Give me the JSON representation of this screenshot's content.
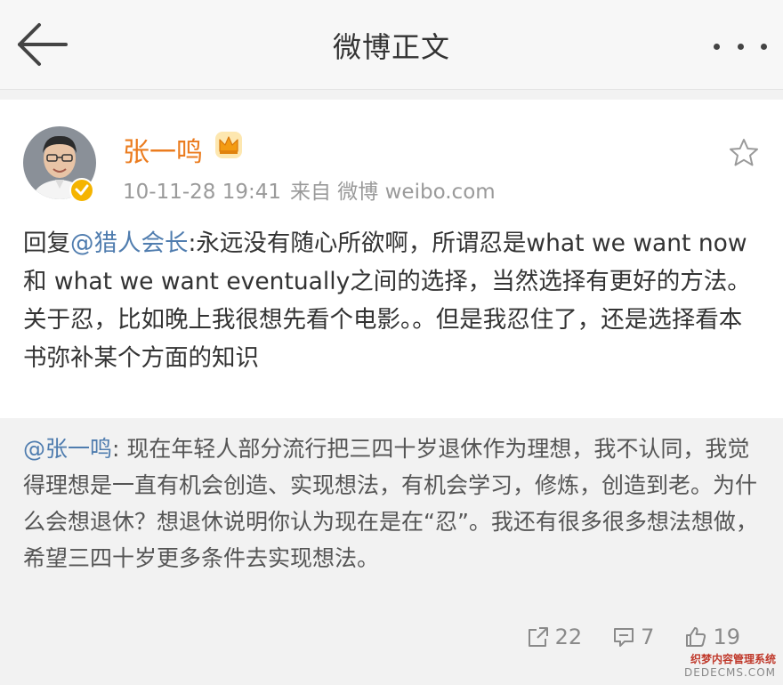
{
  "header": {
    "title": "微博正文"
  },
  "post": {
    "author": "张一鸣",
    "timestamp": "10-11-28 19:41",
    "source": "来自 微博 weibo.com",
    "content": {
      "prefix": "回复",
      "mention": "@猎人会长",
      "text": ":永远没有随心所欲啊，所谓忍是what we want now 和 what we want eventually之间的选择，当然选择有更好的方法。关于忍，比如晚上我很想先看个电影。。但是我忍住了，还是选择看本书弥补某个方面的知识"
    }
  },
  "quote": {
    "mention": "@张一鸣",
    "text": ": 现在年轻人部分流行把三四十岁退休作为理想，我不认同，我觉得理想是一直有机会创造、实现想法，有机会学习，修炼，创造到老。为什么会想退休？想退休说明你认为现在是在“忍”。我还有很多很多想法想做，希望三四十岁更多条件去实现想法。"
  },
  "actions": {
    "reposts": "22",
    "comments": "7",
    "likes": "19"
  },
  "watermark": {
    "line1": "织梦内容管理系统",
    "line2": "DEDECMS.COM"
  },
  "colors": {
    "username": "#eb7c1f",
    "mention": "#507daf",
    "verified": "#f5b400"
  }
}
